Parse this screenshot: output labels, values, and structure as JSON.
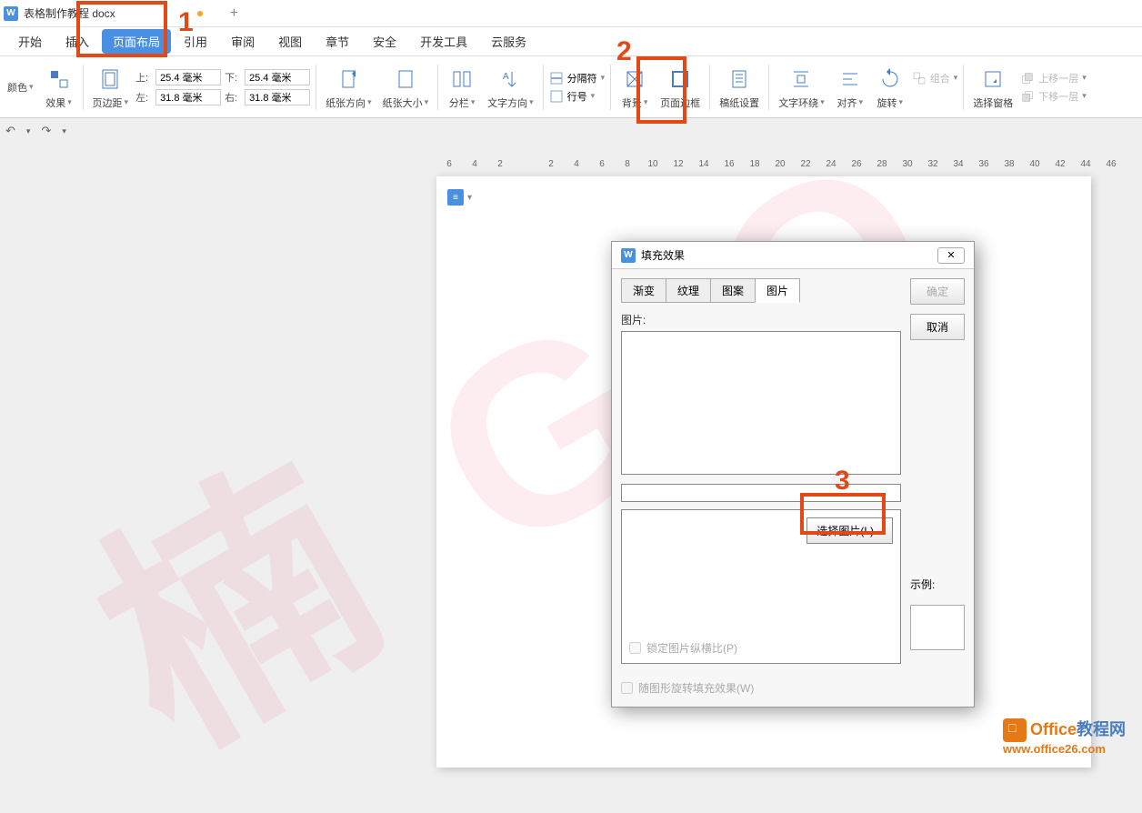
{
  "titlebar": {
    "icon_letter": "W",
    "title": "表格制作教程  docx"
  },
  "menubar": {
    "items": [
      "开始",
      "插入",
      "页面布局",
      "引用",
      "审阅",
      "视图",
      "章节",
      "安全",
      "开发工具",
      "云服务"
    ],
    "active_index": 2
  },
  "ribbon": {
    "color_label": "颜色",
    "effect_label": "效果",
    "margins_label": "页边距",
    "margin_top_label": "上:",
    "margin_top_value": "25.4 毫米",
    "margin_left_label": "左:",
    "margin_left_value": "31.8 毫米",
    "margin_bottom_label": "下:",
    "margin_bottom_value": "25.4 毫米",
    "margin_right_label": "右:",
    "margin_right_value": "31.8 毫米",
    "orientation_label": "纸张方向",
    "size_label": "纸张大小",
    "columns_label": "分栏",
    "text_direction_label": "文字方向",
    "breaks_label": "分隔符",
    "line_number_label": "行号",
    "background_label": "背景",
    "border_label": "页面边框",
    "delete_label": "稿纸设置",
    "wrap_label": "文字环绕",
    "align_label": "对齐",
    "rotate_label": "旋转",
    "select_pane_label": "选择窗格",
    "group_label": "组合",
    "move_up_label": "上移一层",
    "move_down_label": "下移一层"
  },
  "ruler": [
    "6",
    "4",
    "2",
    "",
    "2",
    "4",
    "6",
    "8",
    "10",
    "12",
    "14",
    "16",
    "18",
    "20",
    "22",
    "24",
    "26",
    "28",
    "30",
    "32",
    "34",
    "36",
    "38",
    "40",
    "42",
    "44",
    "46"
  ],
  "dialog": {
    "title": "填充效果",
    "tabs": [
      "渐变",
      "纹理",
      "图案",
      "图片"
    ],
    "active_tab": 3,
    "picture_label": "图片:",
    "select_picture_btn": "选择图片(L)...",
    "lock_ratio_label": "锁定图片纵横比(P)",
    "rotate_fill_label": "随图形旋转填充效果(W)",
    "ok_btn": "确定",
    "cancel_btn": "取消",
    "example_label": "示例:"
  },
  "annotations": {
    "n1": "1",
    "n2": "2",
    "n3": "3"
  },
  "watermark": "楠 G O",
  "footer": {
    "brand1": "Office",
    "brand2": "教程网",
    "url": "www.office26.com"
  }
}
